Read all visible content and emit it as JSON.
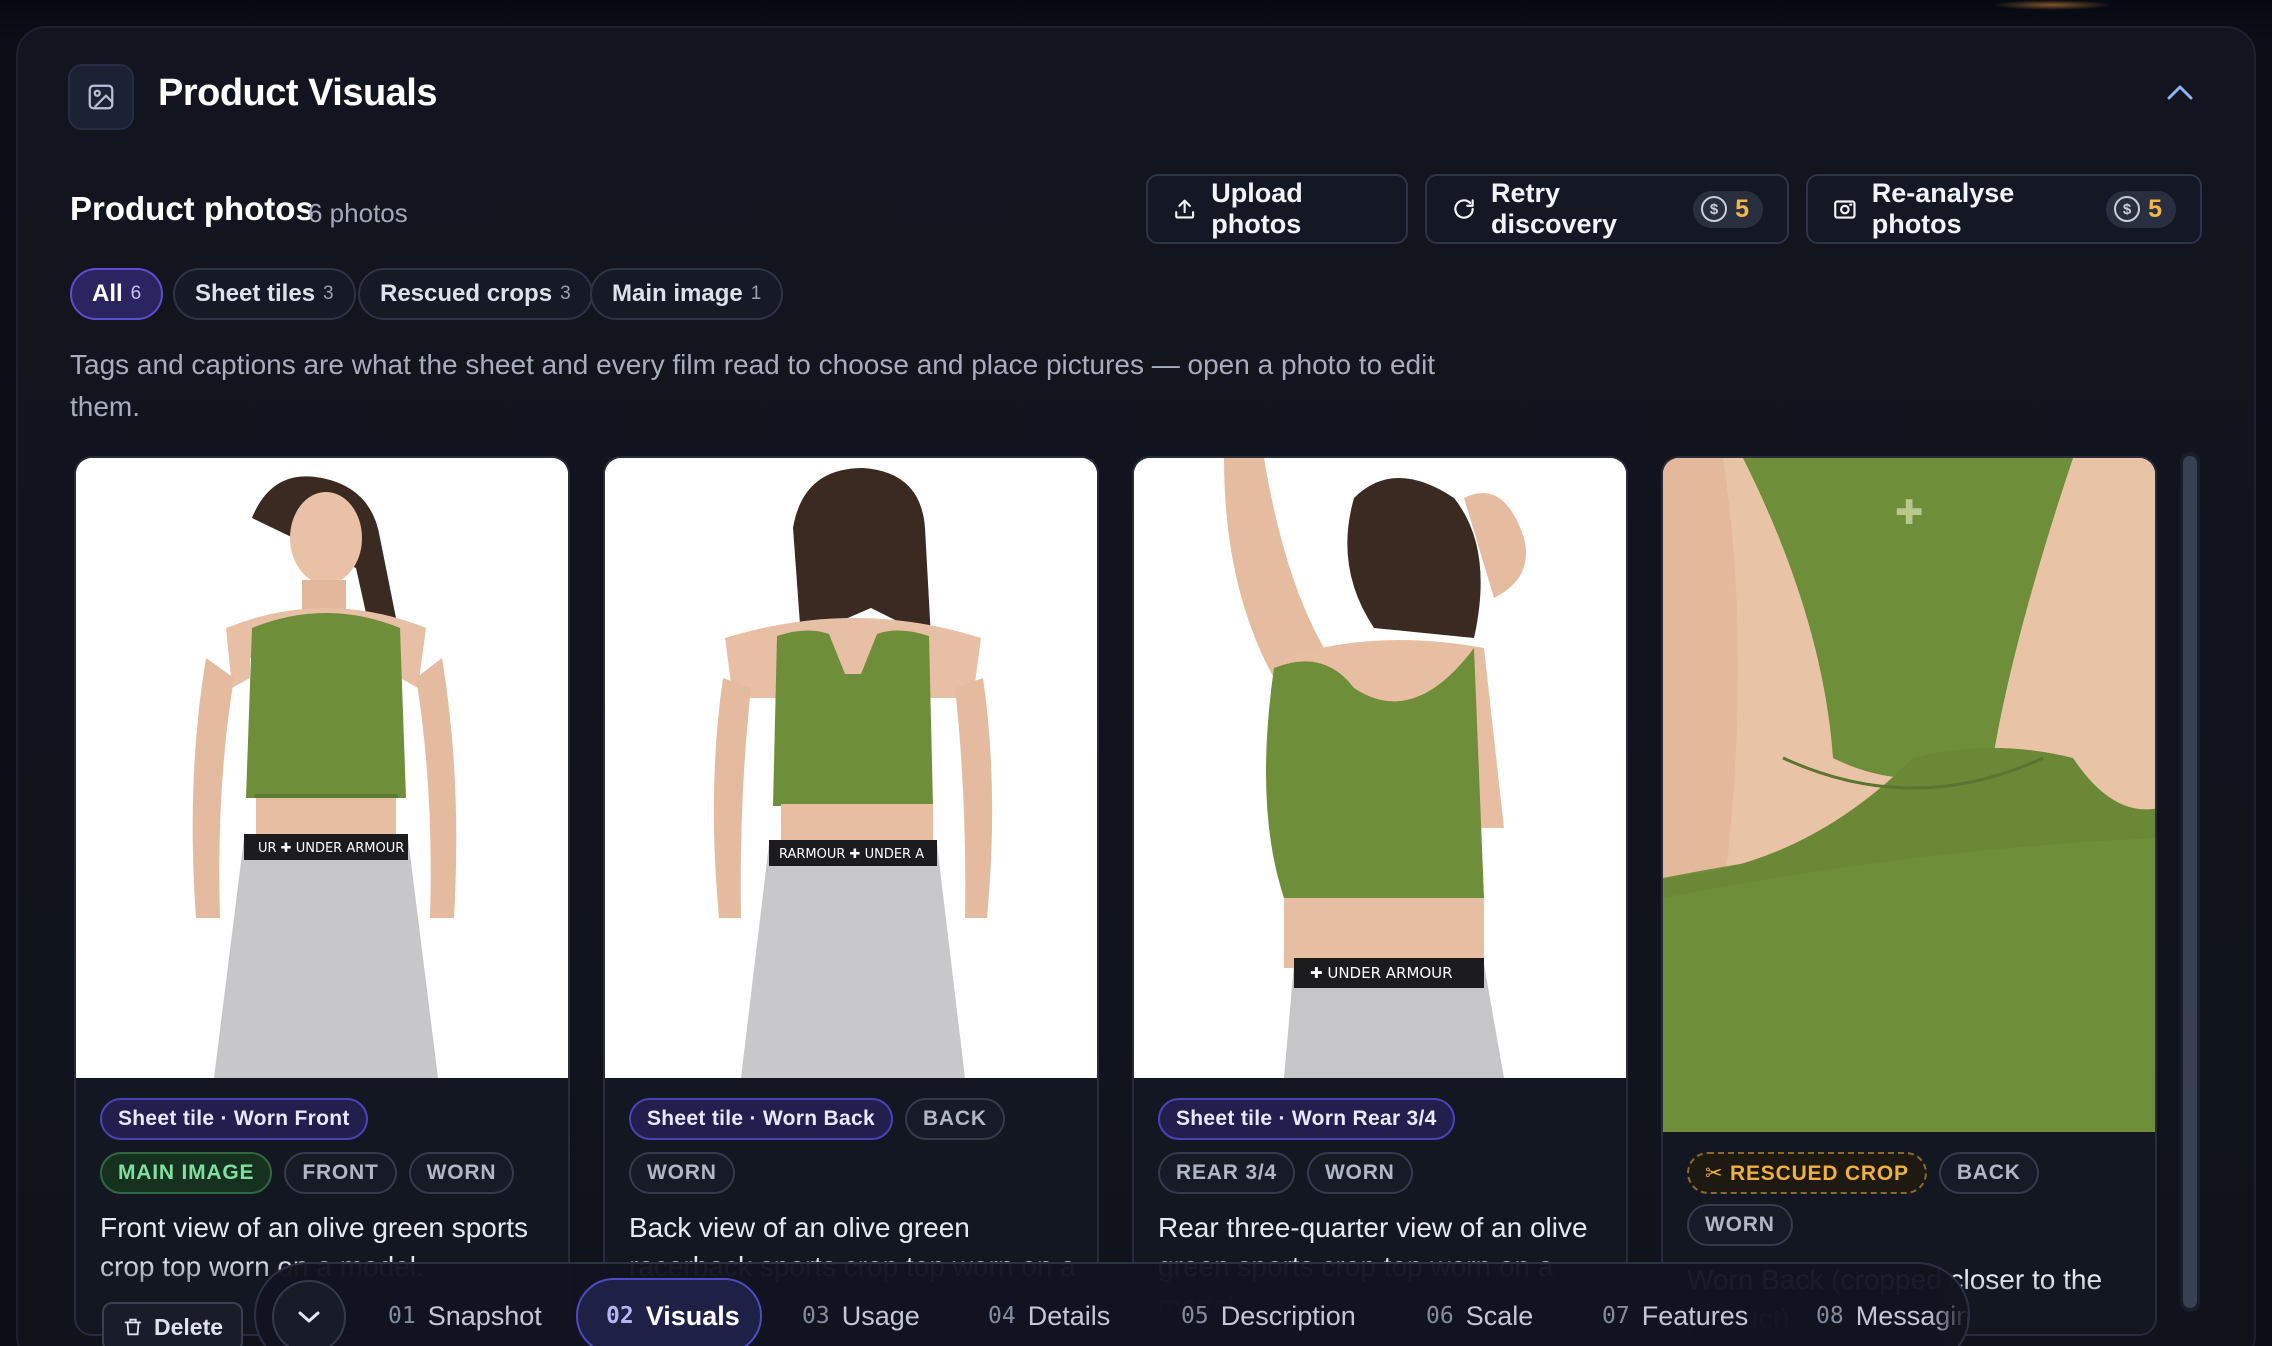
{
  "header": {
    "title": "Product Visuals",
    "icon": "image-icon",
    "collapse_icon": "chevron-up-icon"
  },
  "photos_section": {
    "title": "Product photos",
    "count": "6 photos",
    "buttons": {
      "upload": {
        "label": "Upload photos",
        "icon": "upload-icon"
      },
      "retry": {
        "label": "Retry discovery",
        "icon": "refresh-icon",
        "credits": "5"
      },
      "reanalyse": {
        "label": "Re-analyse photos",
        "icon": "camera-scan-icon",
        "credits": "5"
      }
    },
    "filters": [
      {
        "label": "All",
        "count": "6",
        "active": true
      },
      {
        "label": "Sheet tiles",
        "count": "3",
        "active": false
      },
      {
        "label": "Rescued crops",
        "count": "3",
        "active": false
      },
      {
        "label": "Main image",
        "count": "1",
        "active": false
      }
    ],
    "hint": "Tags and captions are what the sheet and every film read to choose and place pictures — open a photo to edit them."
  },
  "cards": [
    {
      "tag_primary": "Sheet tile · Worn Front",
      "tags": [
        "MAIN IMAGE",
        "FRONT",
        "WORN"
      ],
      "caption": "Front view of an olive green sports crop top worn on a model.",
      "delete_label": "Delete"
    },
    {
      "tag_primary": "Sheet tile · Worn Back",
      "tag_inline": "BACK",
      "tags": [
        "WORN"
      ],
      "caption": "Back view of an olive green racerback sports crop top worn on a model."
    },
    {
      "tag_primary": "Sheet tile · Worn Rear 3/4",
      "tags": [
        "REAR 3/4",
        "WORN"
      ],
      "caption": "Rear three-quarter view of an olive green sports crop top worn on a model."
    },
    {
      "tag_rescued": "✂ RESCUED CROP",
      "tags": [
        "BACK",
        "WORN"
      ],
      "caption": "Worn Back (cropped closer to the product)"
    }
  ],
  "bottom_nav": {
    "toggle_icon": "chevron-down-icon",
    "items": [
      {
        "num": "01",
        "label": "Snapshot"
      },
      {
        "num": "02",
        "label": "Visuals",
        "active": true
      },
      {
        "num": "03",
        "label": "Usage"
      },
      {
        "num": "04",
        "label": "Details"
      },
      {
        "num": "05",
        "label": "Description"
      },
      {
        "num": "06",
        "label": "Scale"
      },
      {
        "num": "07",
        "label": "Features"
      },
      {
        "num": "08",
        "label": "Messaging"
      }
    ]
  },
  "colors": {
    "accent": "#5b4fd0",
    "credit": "#f2b744",
    "garment": "#6f8e3a",
    "main_tag": "#7fe0a0",
    "rescued_tag": "#f0b13f"
  }
}
